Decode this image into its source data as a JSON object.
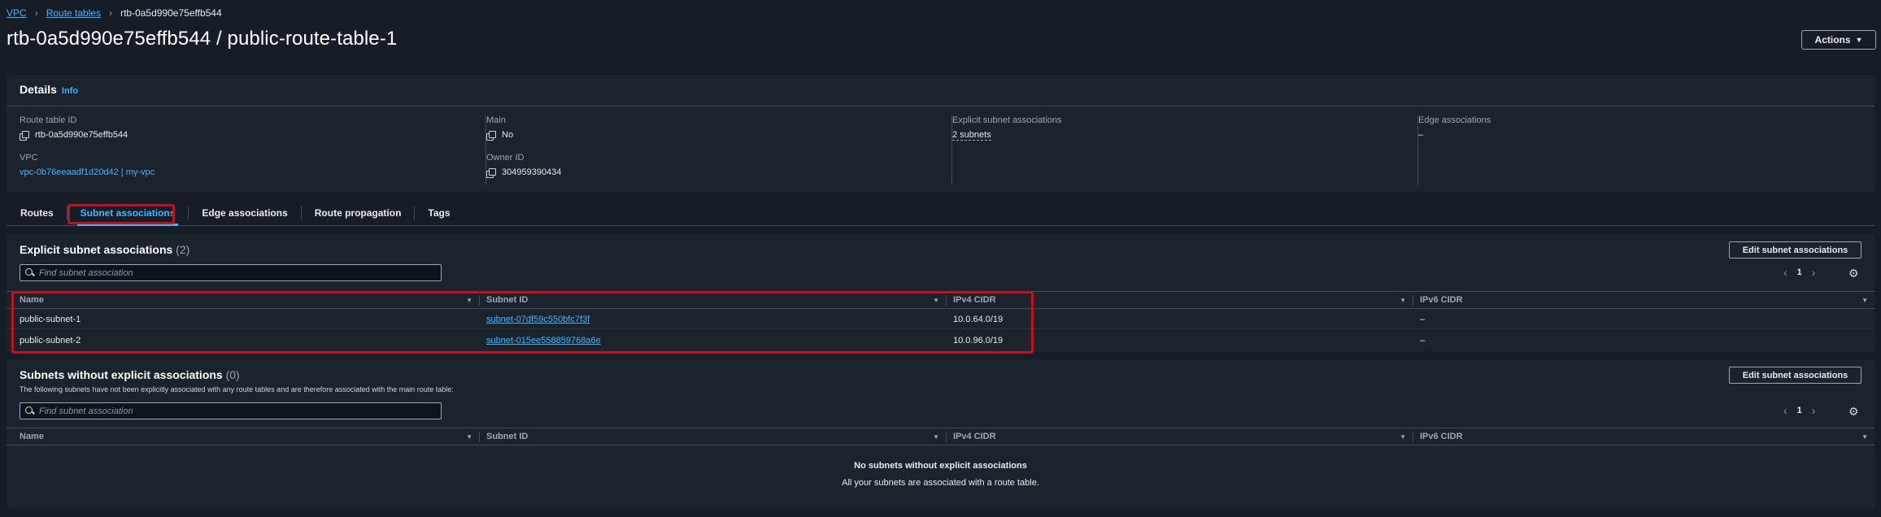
{
  "breadcrumb": {
    "items": [
      "VPC",
      "Route tables"
    ],
    "current": "rtb-0a5d990e75effb544"
  },
  "page_title": "rtb-0a5d990e75effb544 / public-route-table-1",
  "actions_label": "Actions",
  "details": {
    "title": "Details",
    "info_label": "Info",
    "route_table_id": {
      "label": "Route table ID",
      "value": "rtb-0a5d990e75effb544"
    },
    "vpc": {
      "label": "VPC",
      "value": "vpc-0b76eeaadf1d20d42 | my-vpc"
    },
    "main": {
      "label": "Main",
      "value": "No"
    },
    "owner_id": {
      "label": "Owner ID",
      "value": "304959390434"
    },
    "explicit_subnet_associations": {
      "label": "Explicit subnet associations",
      "value": "2 subnets"
    },
    "edge_associations": {
      "label": "Edge associations",
      "value": "–"
    }
  },
  "tabs": [
    "Routes",
    "Subnet associations",
    "Edge associations",
    "Route propagation",
    "Tags"
  ],
  "active_tab": "Subnet associations",
  "explicit": {
    "title": "Explicit subnet associations",
    "count": "(2)",
    "edit_label": "Edit subnet associations",
    "search_placeholder": "Find subnet association",
    "page": "1",
    "columns": [
      "Name",
      "Subnet ID",
      "IPv4 CIDR",
      "IPv6 CIDR"
    ],
    "rows": [
      {
        "name": "public-subnet-1",
        "subnet_id": "subnet-07df59c550bfc7f3f",
        "ipv4": "10.0.64.0/19",
        "ipv6": "–"
      },
      {
        "name": "public-subnet-2",
        "subnet_id": "subnet-015ee558859768a6e",
        "ipv4": "10.0.96.0/19",
        "ipv6": "–"
      }
    ]
  },
  "without": {
    "title": "Subnets without explicit associations",
    "count": "(0)",
    "description": "The following subnets have not been explicitly associated with any route tables and are therefore associated with the main route table:",
    "edit_label": "Edit subnet associations",
    "search_placeholder": "Find subnet association",
    "page": "1",
    "columns": [
      "Name",
      "Subnet ID",
      "IPv4 CIDR",
      "IPv6 CIDR"
    ],
    "empty_title": "No subnets without explicit associations",
    "empty_desc": "All your subnets are associated with a route table."
  },
  "colors": {
    "link": "#42b4ff",
    "highlight": "#c1121f",
    "panel": "#1b232d",
    "background": "#161d26"
  }
}
